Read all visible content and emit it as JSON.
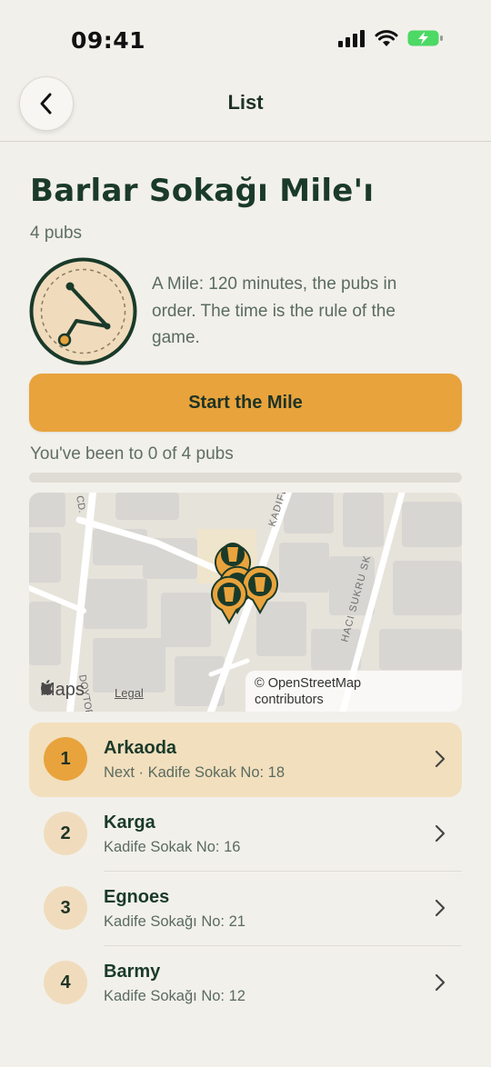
{
  "status": {
    "time": "09:41"
  },
  "nav": {
    "title": "List"
  },
  "header": {
    "title": "Barlar Sokağı Mile'ı",
    "subtitle": "4 pubs",
    "description": "A Mile: 120 minutes, the pubs in order. The time is the rule of the game."
  },
  "actions": {
    "start_label": "Start the Mile"
  },
  "progress": {
    "text": "You've been to 0 of 4 pubs",
    "visited": 0,
    "total": 4
  },
  "map": {
    "logo_text": "Maps",
    "legal_label": "Legal",
    "attribution_line1": "© OpenStreetMap",
    "attribution_line2": "contributors",
    "street_labels": [
      "KADIFE",
      "HACI SUKRU SK",
      "CD.",
      "DOYTOR"
    ]
  },
  "pubs": [
    {
      "number": "1",
      "name": "Arkaoda",
      "sub": "Next · Kadife Sokak No: 18",
      "active": true
    },
    {
      "number": "2",
      "name": "Karga",
      "sub": "Kadife Sokak No: 16",
      "active": false
    },
    {
      "number": "3",
      "name": "Egnoes",
      "sub": "Kadife Sokağı No: 21",
      "active": false
    },
    {
      "number": "4",
      "name": "Barmy",
      "sub": "Kadife Sokağı No: 12",
      "active": false
    }
  ],
  "colors": {
    "accent": "#e8a33c",
    "primary": "#1a3a2a",
    "background": "#f2f0eb",
    "active_row": "#f2dfbd"
  }
}
